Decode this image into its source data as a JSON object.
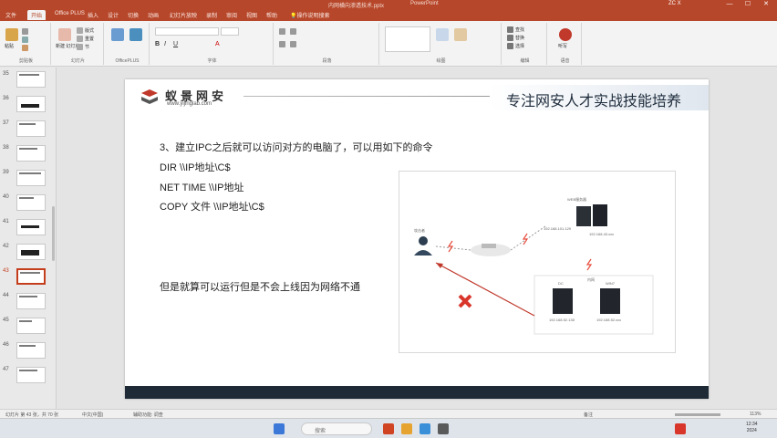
{
  "window": {
    "doc_title": "内网横向渗透技术.pptx",
    "app_name": "PowerPoint",
    "user": "ZC X",
    "minimize": "—",
    "maximize": "☐",
    "close": "✕"
  },
  "tabs": [
    "文件",
    "开始",
    "Office PLUS",
    "插入",
    "设计",
    "切换",
    "动画",
    "幻灯片放映",
    "录制",
    "审阅",
    "视图",
    "帮助",
    "操作说明搜索"
  ],
  "ribbon": {
    "groups": [
      "剪贴板",
      "幻灯片",
      "OfficePLUS",
      "字体",
      "段落",
      "绘图",
      "编辑",
      "语音",
      "加载项"
    ],
    "buttons": {
      "paste": "粘贴",
      "new_slide": "新建\n幻灯片",
      "layout": "版式",
      "reset": "重置",
      "section": "节",
      "find": "查找",
      "replace": "替换",
      "select": "选择",
      "dictate": "听写"
    }
  },
  "thumbnails": {
    "numbers": [
      "35",
      "36",
      "37",
      "38",
      "39",
      "40",
      "41",
      "42",
      "43",
      "44",
      "45",
      "46",
      "47"
    ],
    "selected": "43"
  },
  "slide": {
    "brand_cn": "蚁景网安",
    "brand_url": "www.yijinglab.com",
    "slogan": "专注网安人才实战技能培养",
    "heading": "3、建立IPC之后就可以访问对方的电脑了，可以用如下的命令",
    "cmd1": "DIR \\\\IP地址\\C$",
    "cmd2": "NET TIME \\\\IP地址",
    "cmd3": "COPY 文件 \\\\IP地址\\C$",
    "note": "但是就算可以运行但是不会上线因为网络不通",
    "diagram": {
      "attacker": "攻击者",
      "web_server": "WEB服务器",
      "web_ip1": "192.168.101.129",
      "web_ip2": "192.168.43.xxx",
      "intranet": "内网",
      "host_a": "DC",
      "host_b": "WIN7",
      "host_a_ip": "192.168.52.138",
      "host_b_ip": "192.168.52.xxx"
    }
  },
  "statusbar": {
    "slide_info": "幻灯片 第 43 张，共 70 张",
    "language": "中文(中国)",
    "accessibility": "辅助功能: 调查",
    "notes": "备注",
    "zoom": "113%"
  },
  "taskbar": {
    "search_placeholder": "搜索",
    "time": "12:34",
    "date": "2024"
  },
  "colors": {
    "accent": "#b7472a",
    "footer": "#1e2a36",
    "arrow": "#c0392b"
  }
}
